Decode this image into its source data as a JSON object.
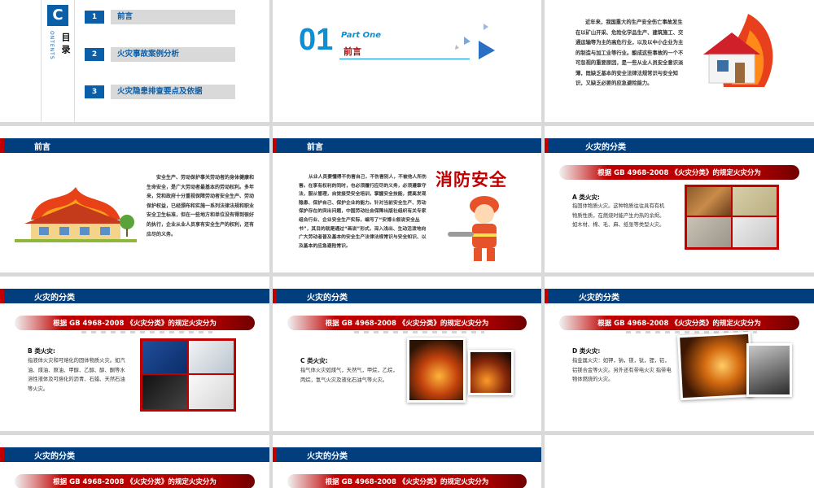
{
  "toc": {
    "letter": "C",
    "vertical": "ONTENTS",
    "title": "目录",
    "items": [
      {
        "num": "1",
        "label": "前言"
      },
      {
        "num": "2",
        "label": "火灾事故案例分析"
      },
      {
        "num": "3",
        "label": "火灾隐患排查要点及依据"
      }
    ]
  },
  "part": {
    "num": "01",
    "label": "Part One",
    "title": "前言"
  },
  "intro_text": "近年来，我国重大的生产安全伤亡事故发生在以矿山开采、危险化学品生产、建筑施工、交通运输等为主的高危行业，以及以中小企业为主的制造与加工业等行业。酿成这些事故的一个不可忽视的重要原因，是一些从业人员安全意识淡薄，既缺乏基本的安全法律法规常识与安全知识，又缺乏必要的应急避险能力。",
  "preface1": {
    "bar": "前言",
    "text": "安全生产、劳动保护事关劳动者的身体健康和生命安全，是广大劳动者最基本的劳动权利。多年来，党和政府十分重视保障劳动者安全生产、劳动保护权益，已经颁布和实施一系列法律法规和职业安全卫生标准，但在一些地方和单位没有得到很好的执行，企业从业人员享有安全生产的权利，还有应尽的义务。"
  },
  "preface2": {
    "bar": "前言",
    "text": "从业人员要懂得不伤害自己，不伤害别人，不被他人所伤害。在享有权利的同时，也必须履行应尽的义务，必须遵章守法，服从管理，自觉接受安全培训，掌握安全技能，提高发现隐患、保护自己、保护企业的能力。针对当前安全生产、劳动保护存在的突出问题，中国劳动社会保障出版社组织有关专家组合行业、企业安全生产实际，编写了“安博士叙说安全丛书”，其目的就是通过“画说”形式，深入浅出、生动活泼地向广大劳动者普及基本的安全生产法律法规常识与安全知识、以及基本的应急避险常识。",
    "sign": "消防安全"
  },
  "fire_class": {
    "bar": "火灾的分类",
    "rule": "根据 GB 4968-2008 《火灾分类》的规定火灾分为"
  },
  "classes": [
    {
      "title": "A 类火灾:",
      "text": "指固体物质火灾。这种物质往往具有有机物质性质，在燃烧时能产生灼热的余烬。如木材、棉、毛、麻、纸张等类型火灾。"
    },
    {
      "title": "B 类火灾:",
      "text": "指液体火灾和可熔化的固体物质火灾。如汽油、煤油、原油、甲醇、乙醇、醇、酮等水溶性液体及可熔化的沥青、石蜡、天然石油等火灾。"
    },
    {
      "title": "C 类火灾:",
      "text": "指气体火灾如煤气，天然气，甲烷，乙烷，丙烷，氢气火灾及液化石油气等火灾。"
    },
    {
      "title": "D 类火灾:",
      "text": "指金属火灾：如钾，钠，镁，钛，锂，铝，铝镁合金等火灾。另外还有带电火灾 指带电物体燃烧的火灾。"
    }
  ],
  "colors": {
    "navy": "#003e7e",
    "blue": "#0b5ea8",
    "red": "#c00000"
  }
}
